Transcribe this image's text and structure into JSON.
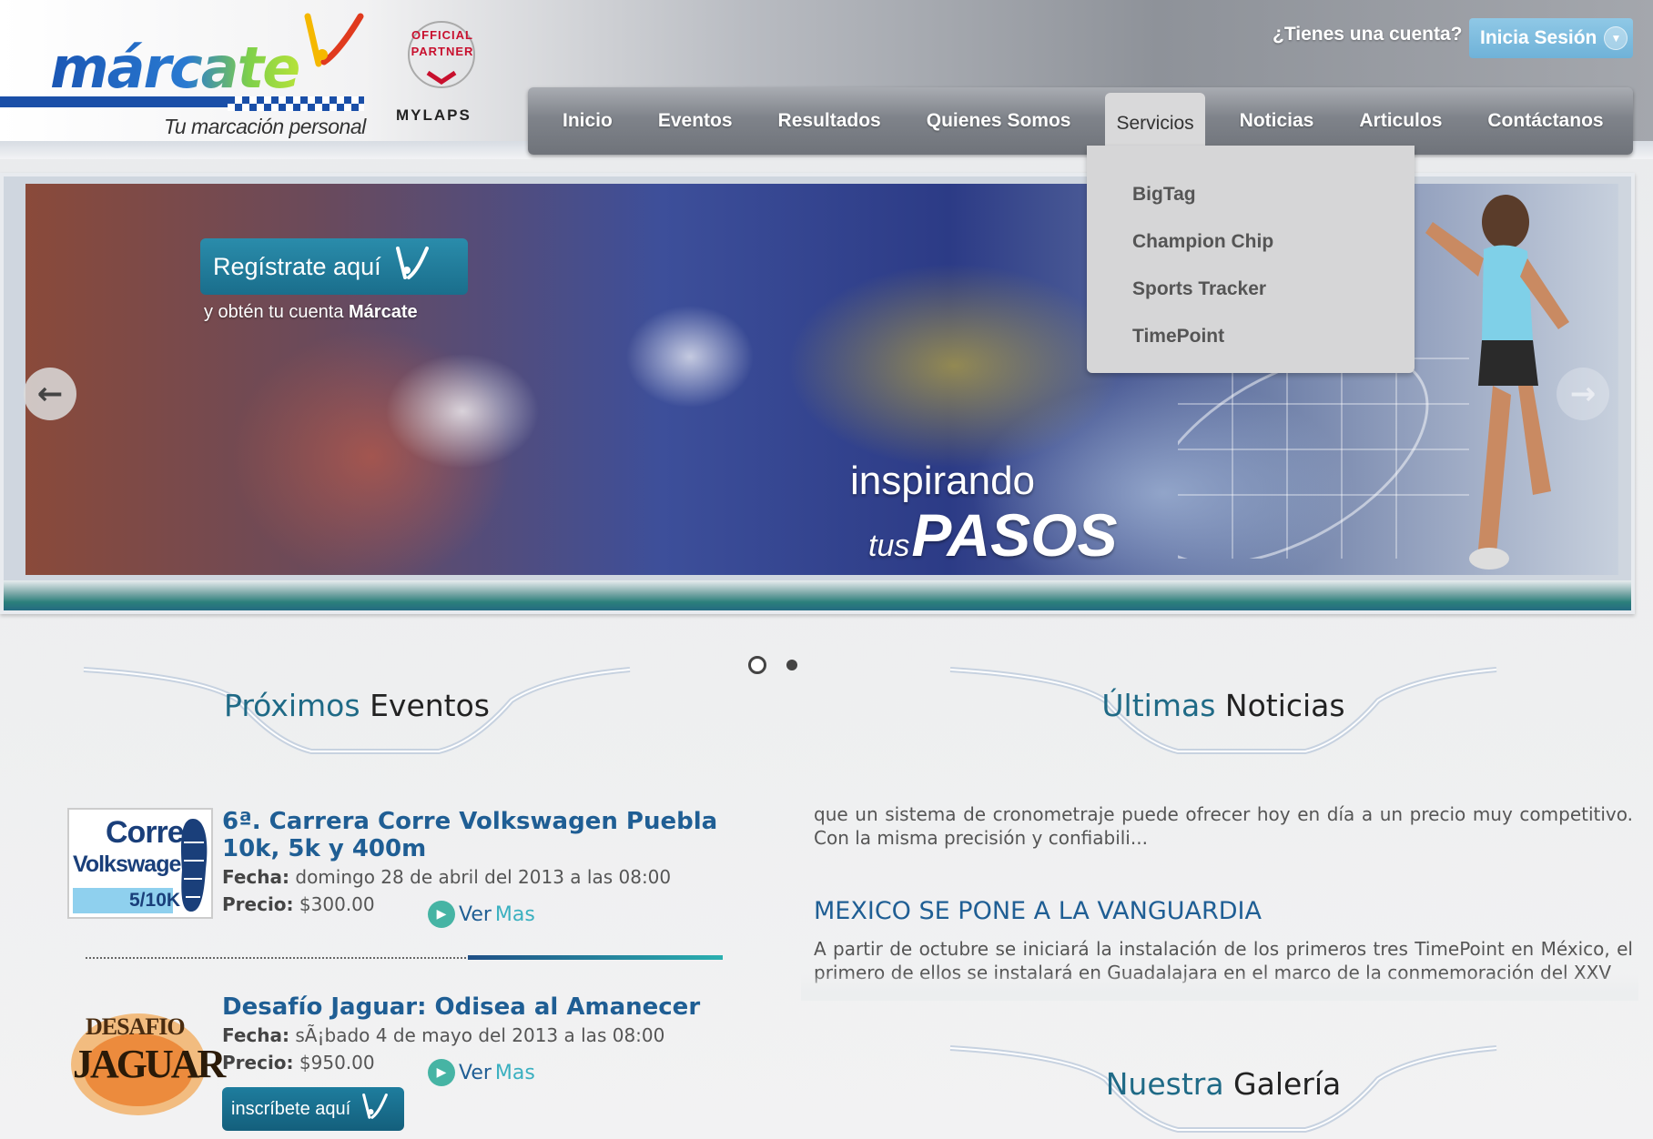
{
  "header": {
    "logo_word": "márcate",
    "logo_tagline": "Tu marcación personal",
    "partner_label": "OFFICIAL PARTNER",
    "mylaps_label": "MYLAPS",
    "account_question": "¿Tienes una cuenta?",
    "login_label": "Inicia Sesión"
  },
  "nav": {
    "items": [
      {
        "label": "Inicio"
      },
      {
        "label": "Eventos"
      },
      {
        "label": "Resultados"
      },
      {
        "label": "Quienes Somos"
      },
      {
        "label": "Servicios"
      },
      {
        "label": "Noticias"
      },
      {
        "label": "Articulos"
      },
      {
        "label": "Contáctanos"
      }
    ],
    "active_index": 4,
    "dropdown": [
      "BigTag",
      "Champion Chip",
      "Sports Tracker",
      "TimePoint"
    ]
  },
  "banner": {
    "register_label": "Regístrate aquí",
    "register_sub_prefix": "y obtén tu cuenta",
    "register_sub_brand": "Márcate",
    "title_line1": "inspirando",
    "title_line2_small": "tus",
    "title_line2_big": "PASOS",
    "slides": 2,
    "active_slide": 1
  },
  "events_section": {
    "title_accent": "Próximos",
    "title_rest": "Eventos",
    "events": [
      {
        "thumb_text1": "Corre",
        "thumb_text2": "Volkswagen",
        "thumb_text3": "5/10K",
        "title": "6ª. Carrera Corre Volkswagen Puebla 10k, 5k y 400m",
        "date_label": "Fecha:",
        "date": "domingo 28 de abril del 2013 a las 08:00",
        "price_label": "Precio:",
        "price": "$300.00",
        "more_a": "Ver",
        "more_b": "Mas"
      },
      {
        "thumb_text1": "DESAFIO",
        "thumb_text2": "JAGUAR",
        "title": "Desafío Jaguar: Odisea al Amanecer",
        "date_label": "Fecha:",
        "date": "sÃ¡bado 4 de mayo del 2013 a las 08:00",
        "price_label": "Precio:",
        "price": "$950.00",
        "more_a": "Ver",
        "more_b": "Mas",
        "cta": "inscríbete aquí"
      }
    ]
  },
  "news_section": {
    "title_accent": "Últimas",
    "title_rest": "Noticias",
    "snippet1": "que un sistema de cronometraje puede ofrecer hoy en día a un precio muy competitivo. Con la misma precisión y confiabili...",
    "headline2": "MEXICO SE PONE A LA VANGUARDIA",
    "snippet2": "A partir de octubre se iniciará la instalación de los primeros tres TimePoint en México, el primero de ellos se instalará en Guadalajara en el marco de la conmemoración del XXV"
  },
  "gallery_section": {
    "title_accent": "Nuestra",
    "title_rest": "Galería"
  },
  "colors": {
    "accent_teal": "#1f6a86",
    "link_blue": "#1f5e94",
    "login_blue": "#7fbde0",
    "nav_gray": "#7f838a"
  },
  "icons": [
    "arrow-left-icon",
    "arrow-right-icon",
    "play-icon",
    "marcate-swoosh-icon",
    "dropdown-caret-icon"
  ]
}
